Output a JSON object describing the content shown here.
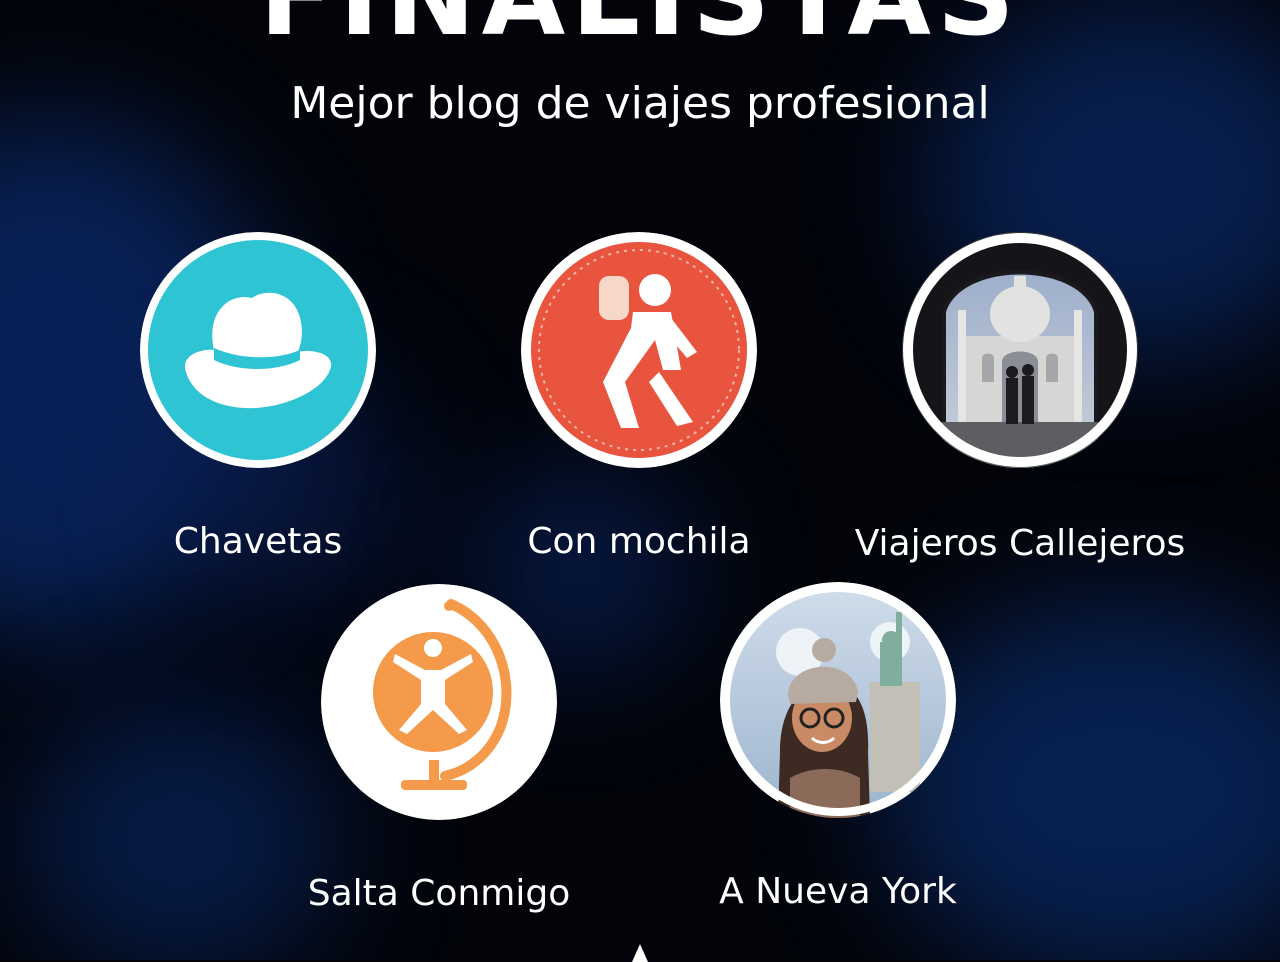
{
  "header": {
    "title": "FINALISTAS",
    "subtitle": "Mejor blog de viajes profesional"
  },
  "finalists": [
    {
      "label": "Chavetas",
      "icon": "white-hat-icon",
      "color": "#2ec4d4"
    },
    {
      "label": "Con mochila",
      "icon": "backpacker-icon",
      "color": "#e9543f"
    },
    {
      "label": "Viajeros Callejeros",
      "icon": "taj-mahal-photo",
      "color": "#8a94a8"
    },
    {
      "label": "Salta Conmigo",
      "icon": "jumping-globe-icon",
      "color": "#f49a4a"
    },
    {
      "label": "A Nueva York",
      "icon": "traveler-portrait-photo",
      "color": "#dfe8f2"
    }
  ],
  "colors": {
    "background": "#02040a",
    "glow": "#0b2a6e",
    "text": "#ffffff"
  }
}
